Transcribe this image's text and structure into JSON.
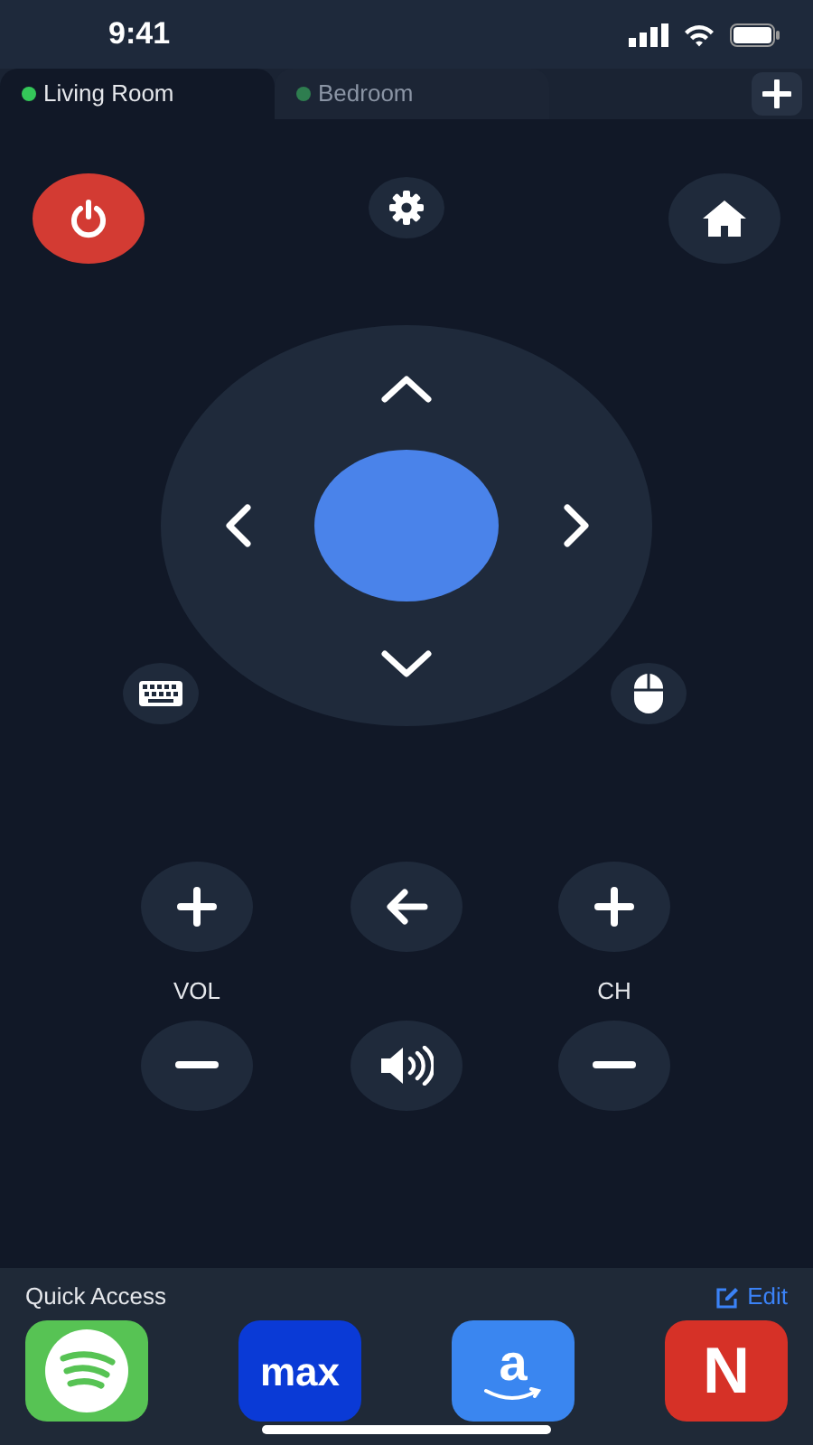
{
  "status_bar": {
    "time": "9:41"
  },
  "tabs": [
    {
      "label": "Living Room",
      "selected": true,
      "color": "#34c759"
    },
    {
      "label": "Bedroom",
      "selected": false,
      "color": "#2e7d4f"
    }
  ],
  "labels": {
    "volume": "VOL",
    "channel": "CH"
  },
  "quick_access": {
    "title": "Quick Access",
    "edit": "Edit",
    "apps": [
      {
        "kind": "spotify"
      },
      {
        "kind": "max",
        "label": "max"
      },
      {
        "kind": "amazon",
        "label": "a"
      },
      {
        "kind": "netflix",
        "label": "N"
      }
    ]
  }
}
